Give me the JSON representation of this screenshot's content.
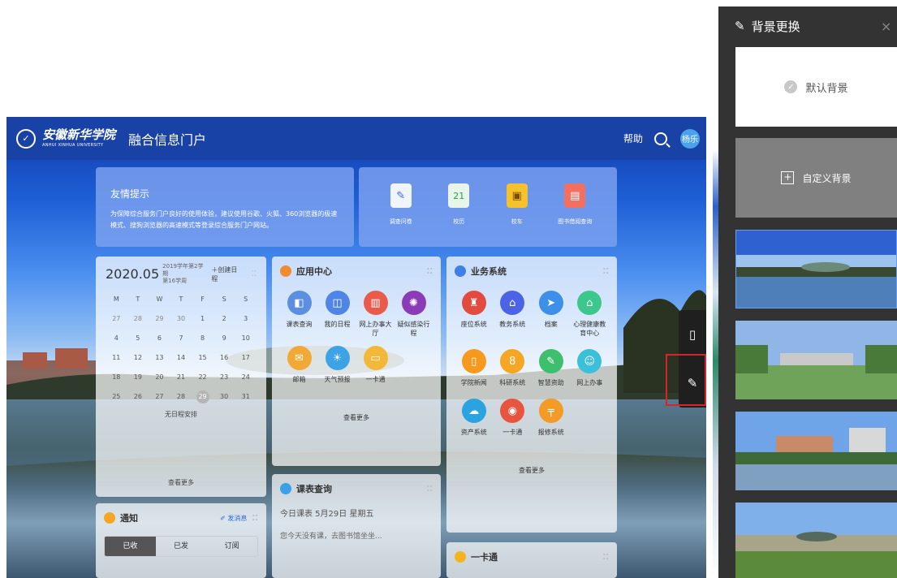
{
  "header": {
    "school_cn": "安徽新华学院",
    "school_en": "ANHUI XINHUA UNIVERSITY",
    "portal_name": "融合信息门户",
    "help": "帮助",
    "user": "杨乐"
  },
  "tip": {
    "title": "友情提示",
    "text": "为保障综合服务门户良好的使用体验，建议使用谷歌、火狐、360浏览器的极速模式、搜狗浏览器的高速模式等登录综合服务门户网站。"
  },
  "quick_links": [
    {
      "label": "调查问卷",
      "color": "#f0f4fb",
      "glyph": "✎"
    },
    {
      "label": "校历",
      "color": "#e8f6ea",
      "glyph": "21"
    },
    {
      "label": "校车",
      "color": "#f5c22e",
      "glyph": "▣"
    },
    {
      "label": "图书借阅查询",
      "color": "#f36f5f",
      "glyph": "▤"
    }
  ],
  "calendar": {
    "month": "2020.05",
    "semester": "2019学年第2学期",
    "week": "第16学周",
    "create": "创建日程",
    "weekdays": [
      "M",
      "T",
      "W",
      "T",
      "F",
      "S",
      "S"
    ],
    "days": [
      "27",
      "28",
      "29",
      "30",
      "1",
      "2",
      "3",
      "4",
      "5",
      "6",
      "7",
      "8",
      "9",
      "10",
      "11",
      "12",
      "13",
      "14",
      "15",
      "16",
      "17",
      "18",
      "19",
      "20",
      "21",
      "22",
      "23",
      "24",
      "25",
      "26",
      "27",
      "28",
      "29",
      "30",
      "31"
    ],
    "today": "29",
    "empty": "无日程安排",
    "more": "查看更多"
  },
  "app_center": {
    "title": "应用中心",
    "more": "查看更多",
    "apps": [
      {
        "label": "课表查询",
        "color": "#5d8fe0",
        "glyph": "◧"
      },
      {
        "label": "我的日程",
        "color": "#4f86e6",
        "glyph": "◫"
      },
      {
        "label": "网上办事大厅",
        "color": "#e85b4b",
        "glyph": "▥"
      },
      {
        "label": "疑似感染行程",
        "color": "#8a3bb5",
        "glyph": "✺"
      },
      {
        "label": "邮箱",
        "color": "#f1a837",
        "glyph": "✉"
      },
      {
        "label": "天气预报",
        "color": "#3ea3e4",
        "glyph": "☀"
      },
      {
        "label": "一卡通",
        "color": "#f3b73a",
        "glyph": "▭"
      }
    ]
  },
  "business": {
    "title": "业务系统",
    "more": "查看更多",
    "apps": [
      {
        "label": "座位系统",
        "color": "#e24b3e",
        "glyph": "♜"
      },
      {
        "label": "教务系统",
        "color": "#4c63e6",
        "glyph": "⌂"
      },
      {
        "label": "档案",
        "color": "#3d8fe8",
        "glyph": "➤"
      },
      {
        "label": "心理健康教育中心",
        "color": "#3cc78c",
        "glyph": "⌂"
      },
      {
        "label": "学院新闻",
        "color": "#f59a1e",
        "glyph": "▯"
      },
      {
        "label": "科研系统",
        "color": "#f5a623",
        "glyph": "8"
      },
      {
        "label": "智慧资助",
        "color": "#3dbf6d",
        "glyph": "✎"
      },
      {
        "label": "网上办事",
        "color": "#3ac0d8",
        "glyph": "☺"
      },
      {
        "label": "资产系统",
        "color": "#2aa3e0",
        "glyph": "☁"
      },
      {
        "label": "一卡通",
        "color": "#e8553f",
        "glyph": "◉"
      },
      {
        "label": "报修系统",
        "color": "#f39a27",
        "glyph": "╤"
      }
    ]
  },
  "course": {
    "title": "课表查询",
    "today": "今日课表 5月29日 星期五",
    "note": "您今天没有课，去图书馆坐坐..."
  },
  "notify": {
    "title": "通知",
    "send": "发消息",
    "tabs": [
      "已收",
      "已发",
      "订阅"
    ]
  },
  "card": {
    "title": "一卡通"
  },
  "bg_panel": {
    "title": "背景更换",
    "default": "默认背景",
    "custom": "自定义背景",
    "close": "×"
  },
  "colors": {
    "primary": "#1942a6",
    "panel": "#333333",
    "alert": "#d8232a"
  }
}
